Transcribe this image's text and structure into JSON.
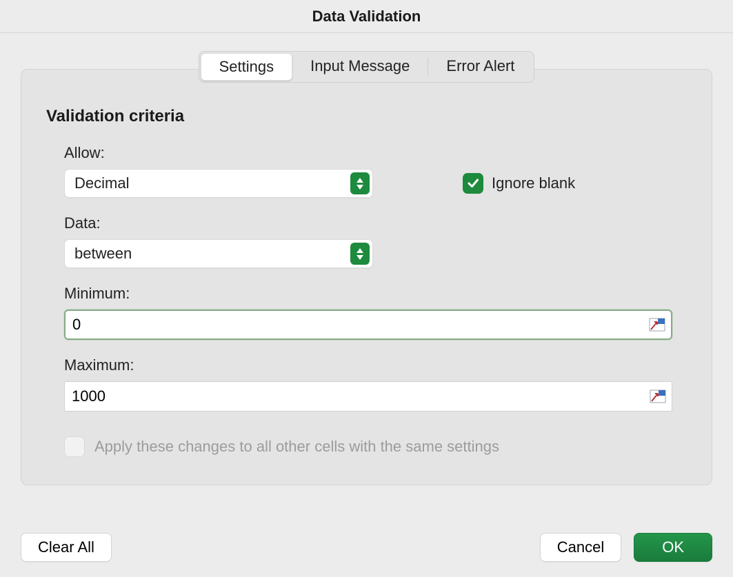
{
  "dialog": {
    "title": "Data Validation"
  },
  "tabs": {
    "settings": "Settings",
    "input_message": "Input Message",
    "error_alert": "Error Alert",
    "active": "settings"
  },
  "section": {
    "title": "Validation criteria"
  },
  "fields": {
    "allow": {
      "label": "Allow:",
      "value": "Decimal"
    },
    "data": {
      "label": "Data:",
      "value": "between"
    },
    "minimum": {
      "label": "Minimum:",
      "value": "0"
    },
    "maximum": {
      "label": "Maximum:",
      "value": "1000"
    }
  },
  "checkboxes": {
    "ignore_blank": {
      "label": "Ignore blank",
      "checked": true
    },
    "apply_all": {
      "label": "Apply these changes to all other cells with the same settings",
      "checked": false,
      "disabled": true
    }
  },
  "buttons": {
    "clear_all": "Clear All",
    "cancel": "Cancel",
    "ok": "OK"
  },
  "colors": {
    "accent_green": "#1d8a3d"
  }
}
